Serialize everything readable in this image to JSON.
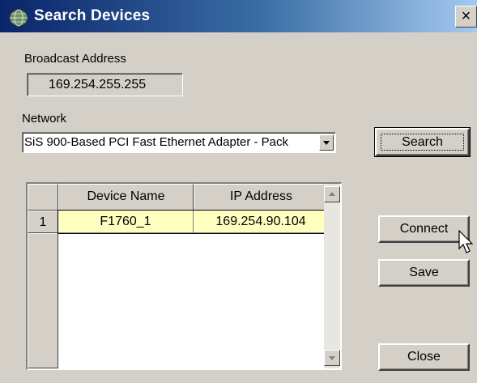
{
  "window": {
    "title": "Search Devices",
    "close_glyph": "×"
  },
  "broadcast": {
    "label": "Broadcast Address",
    "value": "169.254.255.255"
  },
  "network": {
    "label": "Network",
    "selected": "SiS 900-Based PCI Fast Ethernet Adapter - Pack"
  },
  "buttons": {
    "search": "Search",
    "connect": "Connect",
    "save": "Save",
    "close": "Close"
  },
  "table": {
    "columns": [
      "Device Name",
      "IP Address"
    ],
    "rows": [
      {
        "index": "1",
        "device_name": "F1760_1",
        "ip_address": "169.254.90.104"
      }
    ]
  },
  "icons": {
    "app": "network-globe-icon",
    "cursor": "mouse-pointer-icon"
  },
  "colors": {
    "title_bar": "#0a246a",
    "face": "#d4d0c8",
    "selected_row": "#ffffc0"
  }
}
